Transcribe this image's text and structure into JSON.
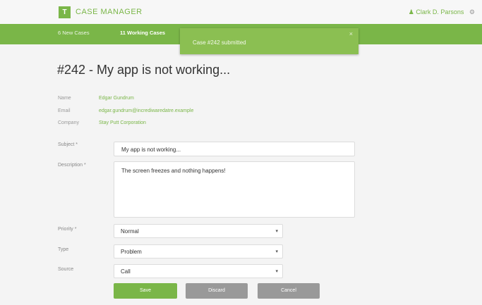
{
  "app": {
    "logo_text": "T",
    "title": "CASE MANAGER"
  },
  "user": {
    "name": "Clark D. Parsons",
    "user_icon": "user-icon",
    "settings_icon": "gear-icon"
  },
  "nav": {
    "tabs": [
      {
        "label": "6 New Cases"
      },
      {
        "label": "11 Working Cases"
      }
    ]
  },
  "toast": {
    "message": "Case #242 submitted",
    "close": "×"
  },
  "case": {
    "title": "#242 - My app is not working...",
    "info": [
      {
        "label": "Name",
        "value": "Edgar Gundrum"
      },
      {
        "label": "Email",
        "value": "edgar.gundrum@incrediwaredatre.example"
      },
      {
        "label": "Company",
        "value": "Stay Putt Corporation"
      }
    ]
  },
  "form": {
    "subject": {
      "label": "Subject *",
      "value": "My app is not working..."
    },
    "description": {
      "label": "Description *",
      "value": "The screen freezes and nothing happens!"
    },
    "priority": {
      "label": "Priority *",
      "value": "Normal"
    },
    "type": {
      "label": "Type",
      "value": "Problem"
    },
    "source": {
      "label": "Source",
      "value": "Call"
    },
    "buttons": {
      "save": "Save",
      "discard": "Discard",
      "cancel": "Cancel"
    }
  },
  "colors": {
    "accent": "#7ab648",
    "background": "#f4f4f4",
    "secondary_button": "#999999"
  }
}
